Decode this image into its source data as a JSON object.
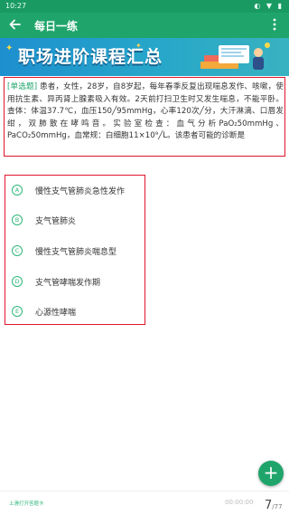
{
  "status_bar": {
    "time": "10:27",
    "icons": "◐ ▼ ▮"
  },
  "app_bar": {
    "title": "每日一练"
  },
  "banner": {
    "title": "职场进阶课程汇总"
  },
  "question": {
    "type_label": "[单选题]",
    "text": " 患者，女性，28岁，自8岁起，每年春季反复出现喘息发作、咳嗽，使用抗生素、异丙肾上腺素吸入有效。2天前打扫卫生时又发生喘息，不能平卧。查体：体温37.7℃，血压150╱95mmHg，心率120次╱分，大汗淋漓、口唇发绀，双肺散在哮鸣音。实验室检查：血气分析PaO₂50mmHg、PaCO₂50mmHg，血常规：白细胞11×10⁹╱L。该患者可能的诊断是"
  },
  "options": [
    {
      "letter": "A",
      "text": "慢性支气管肺炎急性发作"
    },
    {
      "letter": "B",
      "text": "支气管肺炎"
    },
    {
      "letter": "C",
      "text": "慢性支气管肺炎喘息型"
    },
    {
      "letter": "D",
      "text": "支气管哮喘发作期"
    },
    {
      "letter": "E",
      "text": "心源性哮喘"
    }
  ],
  "fab": {
    "label": "+"
  },
  "bottom_bar": {
    "hint": "上滑打开答题卡",
    "timer": "00:00:00",
    "current": "7",
    "total": "/77"
  },
  "colors": {
    "primary": "#1fa56b",
    "highlight_border": "#e0152b",
    "option_accent": "#2db77a"
  }
}
